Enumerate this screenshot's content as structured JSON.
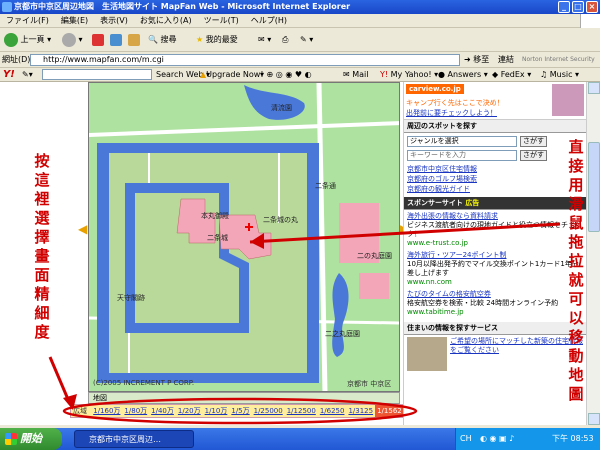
{
  "window": {
    "title": "京都市中京区周辺地図　生活地図サイト MapFan Web - Microsoft Internet Explorer"
  },
  "menu": {
    "items": [
      "ファイル(F)",
      "編集(E)",
      "表示(V)",
      "お気に入り(A)",
      "ツール(T)",
      "ヘルプ(H)"
    ]
  },
  "toolbar": {
    "back_label": "上一頁",
    "search_label": "搜尋",
    "favorites_label": "我的最愛"
  },
  "address": {
    "label": "網址(D)",
    "url": "http://www.mapfan.com/m.cgi",
    "go_label": "移至",
    "links_label": "連結",
    "norton_label": "Norton Internet Security"
  },
  "yahoo": {
    "search_web": "Search Web",
    "upgrade": "Upgrade Now!",
    "mail": "Mail",
    "my_yahoo": "My Yahoo!",
    "answers": "Answers",
    "fedex": "FedEx",
    "music": "Music"
  },
  "map": {
    "labels": {
      "pond_top": "清流園",
      "honmaru": "本丸御殿",
      "ninomaru_goten": "二条城",
      "nijojo": "二条城",
      "ninomaru": "二条城の丸",
      "tenshu": "天守閣跡",
      "garden": "二之丸庭園",
      "nijo_dori": "二条通",
      "garden_right": "二の丸庭園"
    },
    "copyright": "(C)2005 INCREMENT P CORP.",
    "district": "京都市 中京区",
    "bottom_label": "地図"
  },
  "scale": {
    "label": "広域",
    "items": [
      "1/160万",
      "1/80万",
      "1/40万",
      "1/20万",
      "1/10万",
      "1/5万",
      "1/25000",
      "1/12500",
      "1/6250",
      "1/3125",
      "1/1562"
    ],
    "selected": 10
  },
  "right": {
    "ad_brand": "carview.co.jp",
    "ad_text": "キャンプ行く先はここで決め！",
    "ad_link": "出発前に要チェックしよう！",
    "nearby_title": "周辺のスポットを探す",
    "genre_select": "ジャンルを選択",
    "search_btn": "さがす",
    "keyword_placeholder": "キーワードを入力",
    "links": [
      "京都市中京区住宅情報",
      "京都府のゴルフ場検索",
      "京都府の観光ガイド"
    ],
    "sponsor_title": "スポンサーサイト",
    "sponsor_tag": "広告",
    "sponsors": [
      {
        "title": "海外出張の情報なら資料請求",
        "body": "ビジネス渡航者向けの現地ガイドと役立つ情報をチェック！",
        "url": "www.e-trust.co.jp"
      },
      {
        "title": "海外旅行・ツアー24ポイント制",
        "body": "10月以降出発予約でマイル交換ポイント1カード1年分差し上げます",
        "url": "www.nn.com"
      },
      {
        "title": "たびのタイムの格安航空券",
        "body": "格安航空券を検索・比較 24時間オンライン予約",
        "url": "www.tabitime.jp"
      }
    ],
    "living_title": "住まいの情報を探すサービス",
    "living_text": "ご希望の場所にマッチした新築の住宅情報をご覧ください"
  },
  "annotations": {
    "left": "按這裡選擇畫面精細度",
    "right": "直接用滑鼠拖拉就可以移動地圖"
  },
  "taskbar": {
    "start": "開始",
    "item": "京都市中京区周辺…",
    "tray_lang": "CH",
    "tray_time": "下午 08:53"
  },
  "colors": {
    "annotation": "#d10000",
    "moat": "#4a78d8",
    "castle_ground": "#b9d99a",
    "building": "#f2a6b8",
    "park": "#aee2a0",
    "road": "#ffffff"
  }
}
